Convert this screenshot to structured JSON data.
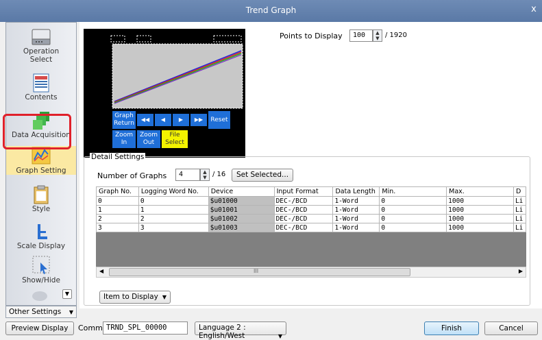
{
  "window": {
    "title": "Trend Graph",
    "close_glyph": "x"
  },
  "sidebar": {
    "items": [
      {
        "label": "Operation\nSelect",
        "icon": "monitor-icon"
      },
      {
        "label": "Contents",
        "icon": "document-icon"
      },
      {
        "label": "Data Acquisition",
        "icon": "stack-icon"
      },
      {
        "label": "Graph Setting",
        "icon": "graph-icon",
        "active": true
      },
      {
        "label": "Style",
        "icon": "clipboard-icon"
      },
      {
        "label": "Scale Display",
        "icon": "scale-icon"
      },
      {
        "label": "Show/Hide",
        "icon": "cursor-icon"
      }
    ],
    "other_settings": "Other Settings"
  },
  "preview": {
    "buttons": {
      "graph_return": "Graph Return",
      "prev_fast": "◀◀",
      "prev": "◀",
      "next": "▶",
      "next_fast": "▶▶",
      "reset": "Reset",
      "zoom_in": "Zoom In",
      "zoom_out": "Zoom Out",
      "file_select": "File Select"
    }
  },
  "points": {
    "label": "Points to Display",
    "value": "100",
    "max": "/ 1920"
  },
  "detail": {
    "legend": "Detail Settings",
    "num_graphs_label": "Number of Graphs",
    "num_graphs_value": "4",
    "num_graphs_max": "/ 16",
    "set_selected": "Set Selected..."
  },
  "table": {
    "headers": [
      "Graph No.",
      "Logging Word No.",
      "Device",
      "Input Format",
      "Data Length",
      "Min.",
      "Max.",
      "D"
    ],
    "rows": [
      [
        "0",
        "0",
        "$u01000",
        "DEC-/BCD",
        "1-Word",
        "0",
        "1000",
        "Li"
      ],
      [
        "1",
        "1",
        "$u01001",
        "DEC-/BCD",
        "1-Word",
        "0",
        "1000",
        "Li"
      ],
      [
        "2",
        "2",
        "$u01002",
        "DEC-/BCD",
        "1-Word",
        "0",
        "1000",
        "Li"
      ],
      [
        "3",
        "3",
        "$u01003",
        "DEC-/BCD",
        "1-Word",
        "0",
        "1000",
        "Li"
      ]
    ],
    "scroll_mark": "III"
  },
  "item_to_display": "Item to Display",
  "bottom": {
    "preview_display": "Preview Display",
    "comm_label": "Comm",
    "comm_value": "TRND_SPL_00000",
    "language": "Language 2 : English/West",
    "finish": "Finish",
    "cancel": "Cancel"
  },
  "colors": {
    "accent": "#e0202a",
    "titlebar": "#5a79a6",
    "preview_btn": "#1f6fd8",
    "file_select": "#f3f300"
  }
}
